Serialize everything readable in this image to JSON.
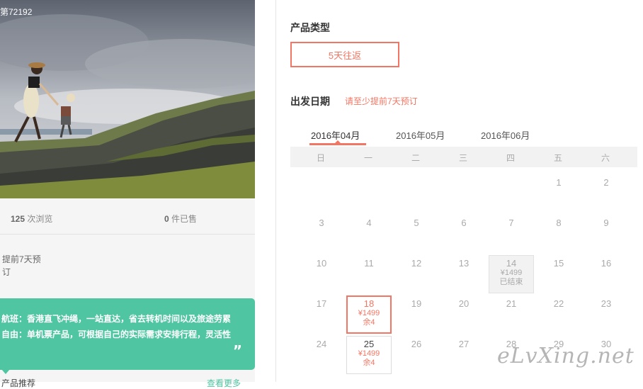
{
  "photo": {
    "id_text": "第72192"
  },
  "stats": {
    "views_count": "125",
    "views_label": "次浏览",
    "sold_count": "0",
    "sold_label": "件已售"
  },
  "booking_note": {
    "line1": "提前7天预",
    "line2": "订"
  },
  "highlights": {
    "line1": "航班：香港直飞冲绳，一站直达，省去转机时间以及旅途劳累",
    "line2": "自由：单机票产品，可根据自己的实际需求安排行程，灵活性",
    "quote_mark": "”"
  },
  "bottom": {
    "left_text": "产品推荐",
    "right_text": "查看更多"
  },
  "product_type": {
    "label": "产品类型",
    "option": "5天往返"
  },
  "departure": {
    "label": "出发日期",
    "hint": "请至少提前7天预订"
  },
  "months": [
    "2016年04月",
    "2016年05月",
    "2016年06月"
  ],
  "weekdays": [
    "日",
    "一",
    "二",
    "三",
    "四",
    "五",
    "六"
  ],
  "calendar": {
    "plain_days": [
      "1",
      "2",
      "3",
      "4",
      "5",
      "6",
      "7",
      "8",
      "9",
      "10",
      "11",
      "12",
      "13",
      "15",
      "16",
      "17",
      "19",
      "20",
      "21",
      "22",
      "23",
      "24",
      "26",
      "27",
      "28",
      "29",
      "30"
    ],
    "day14": {
      "num": "14",
      "price": "¥1499",
      "status": "已结束"
    },
    "day18": {
      "num": "18",
      "price": "¥1499",
      "stock": "余4"
    },
    "day25": {
      "num": "25",
      "price": "¥1499",
      "stock": "余4"
    }
  },
  "watermark": "eLvXing.net",
  "colors": {
    "accent": "#f27663",
    "green": "#4fc5a1"
  }
}
